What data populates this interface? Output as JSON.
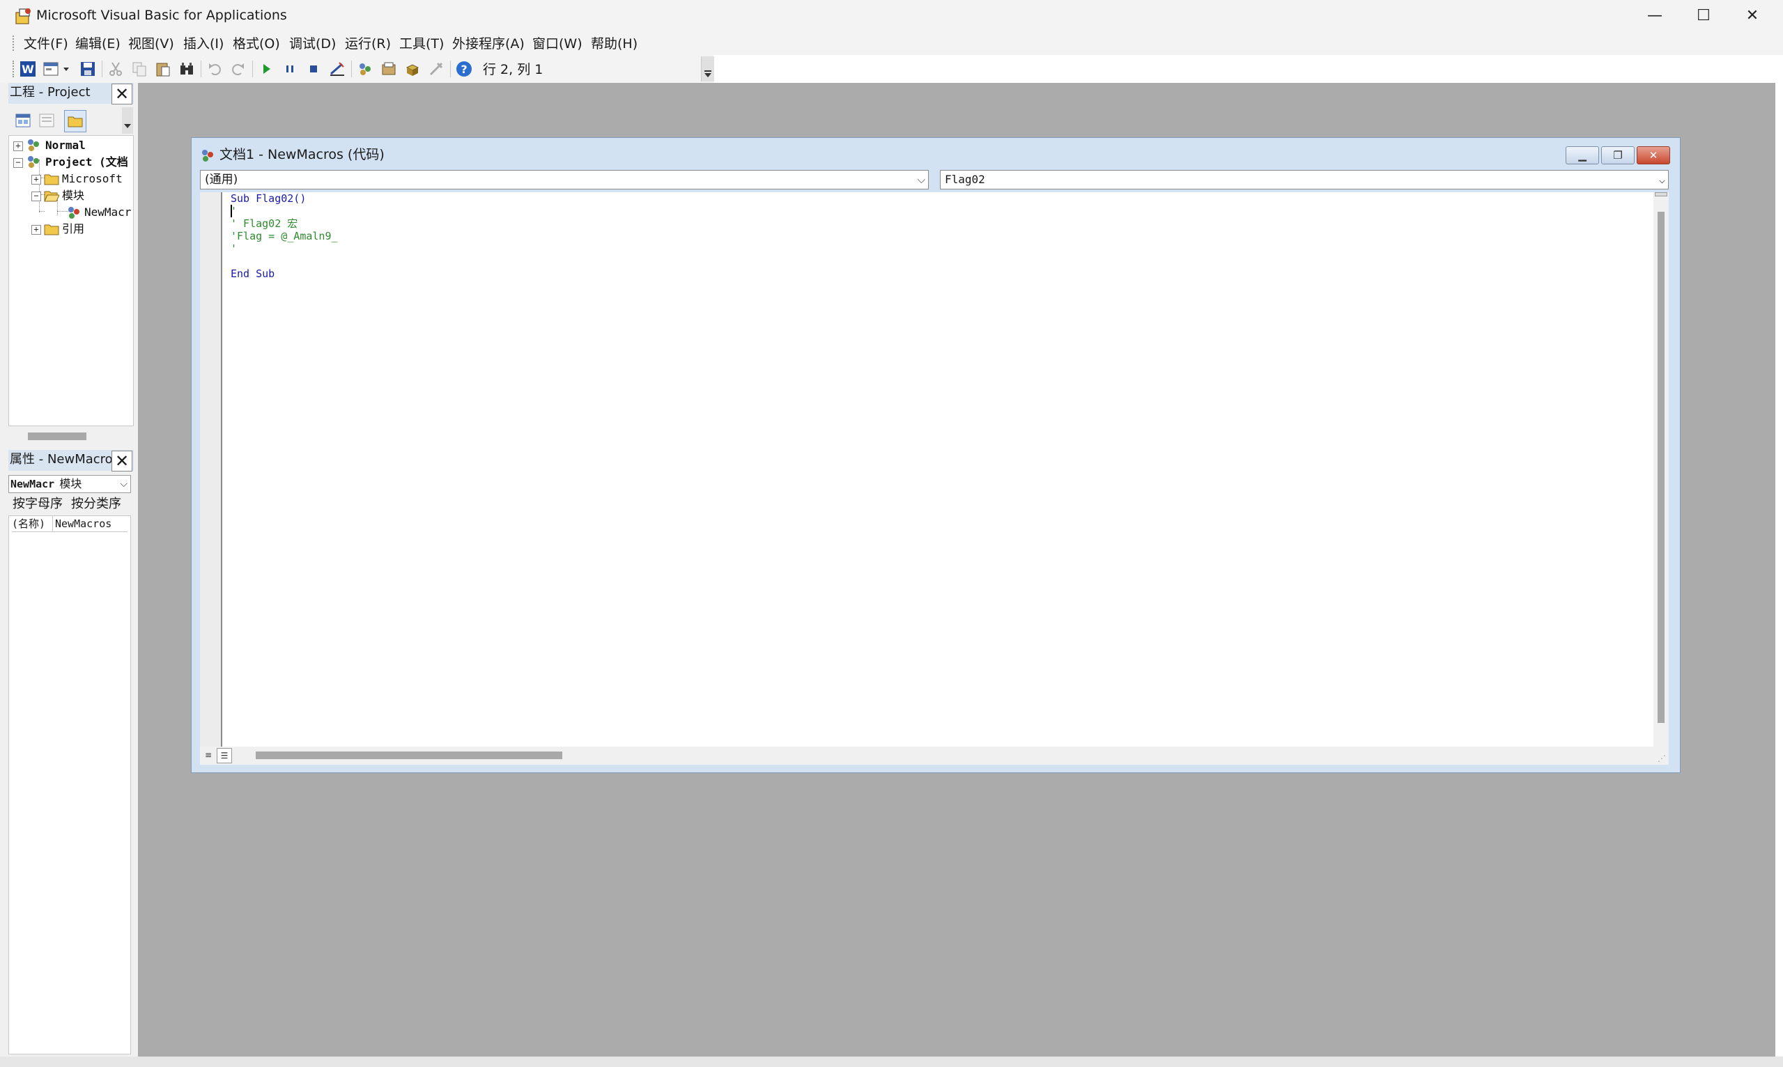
{
  "window": {
    "title": "Microsoft Visual Basic for Applications",
    "minimize": "—",
    "maximize": "☐",
    "close": "✕"
  },
  "menu": [
    {
      "label": "文件(F)"
    },
    {
      "label": "编辑(E)"
    },
    {
      "label": "视图(V)"
    },
    {
      "label": "插入(I)"
    },
    {
      "label": "格式(O)"
    },
    {
      "label": "调试(D)"
    },
    {
      "label": "运行(R)"
    },
    {
      "label": "工具(T)"
    },
    {
      "label": "外接程序(A)"
    },
    {
      "label": "窗口(W)"
    },
    {
      "label": "帮助(H)"
    }
  ],
  "toolbar": {
    "cursor_position": "行 2, 列 1",
    "icons": [
      "word-icon",
      "insert-userform-icon",
      "save-icon",
      "cut-icon",
      "copy-icon",
      "paste-icon",
      "find-icon",
      "undo-icon",
      "redo-icon",
      "run-icon",
      "break-icon",
      "reset-icon",
      "design-mode-icon",
      "project-explorer-icon",
      "properties-icon",
      "object-browser-icon",
      "toolbox-icon",
      "help-icon"
    ]
  },
  "project_panel": {
    "title": "工程 - Project",
    "close": "✕",
    "tree": [
      {
        "label": "Normal",
        "toggle": "+"
      },
      {
        "label": "Project (文档",
        "toggle": "−"
      },
      {
        "label": "Microsoft",
        "toggle": "+"
      },
      {
        "label": "模块",
        "toggle": "−"
      },
      {
        "label": "NewMacr",
        "toggle": ""
      },
      {
        "label": "引用",
        "toggle": "+"
      }
    ]
  },
  "properties_panel": {
    "title": "属性 - NewMacros",
    "close": "✕",
    "object_name": "NewMacr",
    "object_type": "模块",
    "tab_alpha": "按字母序",
    "tab_category": "按分类序",
    "rows": [
      {
        "name": "(名称)",
        "value": "NewMacros"
      }
    ]
  },
  "code_window": {
    "title": "文档1 - NewMacros (代码)",
    "object_combo": "(通用)",
    "procedure_combo": "Flag02",
    "lines": [
      {
        "text": "Sub Flag02()",
        "style": "kw"
      },
      {
        "text": "'",
        "style": "cm"
      },
      {
        "text": "' Flag02 宏",
        "style": "cm"
      },
      {
        "text": "'Flag = @_Amaln9_",
        "style": "cm"
      },
      {
        "text": "'",
        "style": "cm"
      },
      {
        "text": "",
        "style": "plain"
      },
      {
        "text": "End Sub",
        "style": "kw"
      }
    ]
  }
}
